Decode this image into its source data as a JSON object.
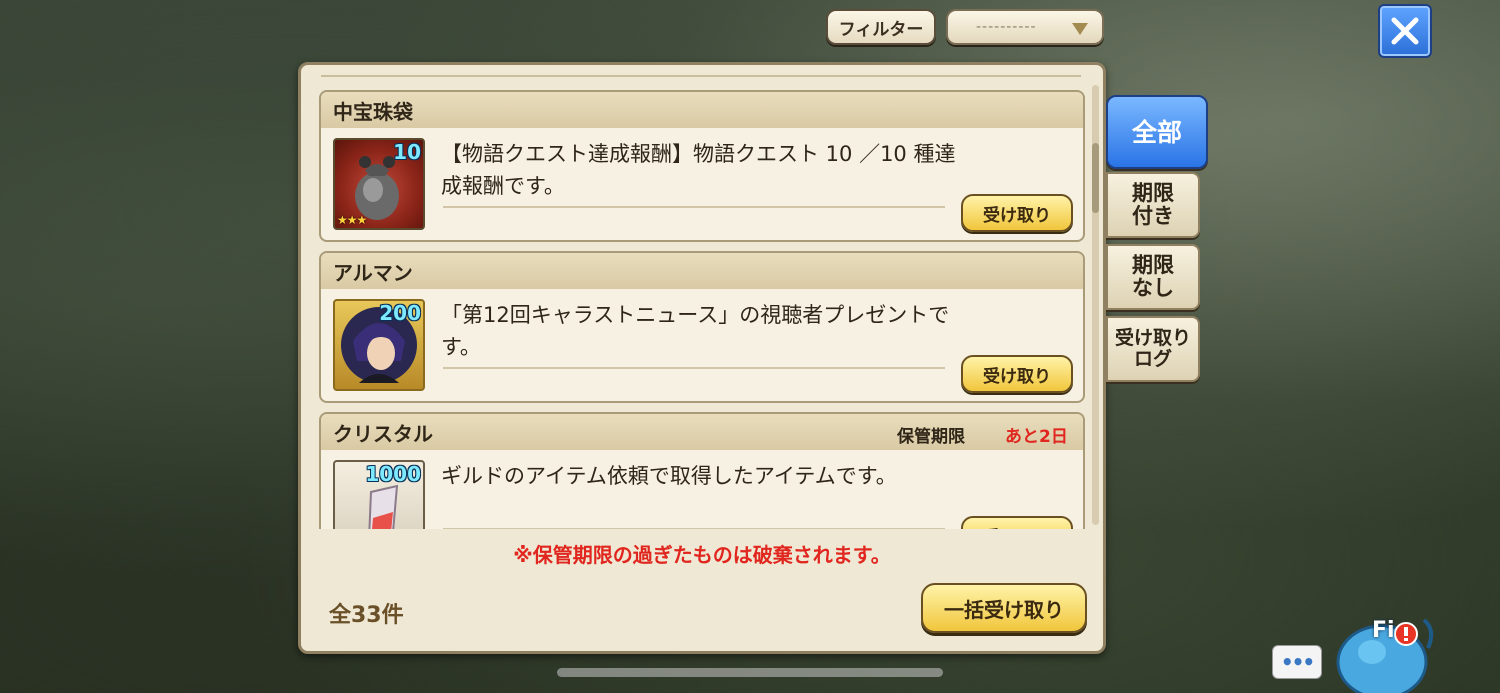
{
  "top": {
    "filter_label": "フィルター",
    "filter_select_value": "----------",
    "close_icon": "close-x-icon"
  },
  "items": [
    {
      "name": "中宝珠袋",
      "quantity": "10",
      "stars": "★★★",
      "description": "【物語クエスト達成報酬】物語クエスト 10 ／10 種達成報酬です。",
      "claim_label": "受け取り",
      "icon": "jewel-bag-icon"
    },
    {
      "name": "アルマン",
      "quantity": "200",
      "description": "「第12回キャラストニュース」の視聴者プレゼントです。",
      "claim_label": "受け取り",
      "icon": "character-portrait-icon"
    },
    {
      "name": "クリスタル",
      "quantity": "1000",
      "limit_label": "保管期限",
      "limit_value": "あと2日",
      "description": "ギルドのアイテム依頼で取得したアイテムです。",
      "claim_label": "受け取り",
      "icon": "crystal-icon"
    }
  ],
  "footer": {
    "warning": "※保管期限の過ぎたものは破棄されます。",
    "total": "全33件",
    "bulk_claim_label": "一括受け取り"
  },
  "tabs": [
    {
      "label": "全部",
      "active": true
    },
    {
      "label": "期限\n付き",
      "active": false
    },
    {
      "label": "期限\nなし",
      "active": false
    },
    {
      "label": "受け取り\nログ",
      "active": false
    }
  ],
  "bottom": {
    "chat_label": "•••",
    "mascot_text": "Fi"
  },
  "colors": {
    "accent_blue": "#2a74e6",
    "claim_gold": "#f1c63c",
    "warning_red": "#e0261e"
  }
}
